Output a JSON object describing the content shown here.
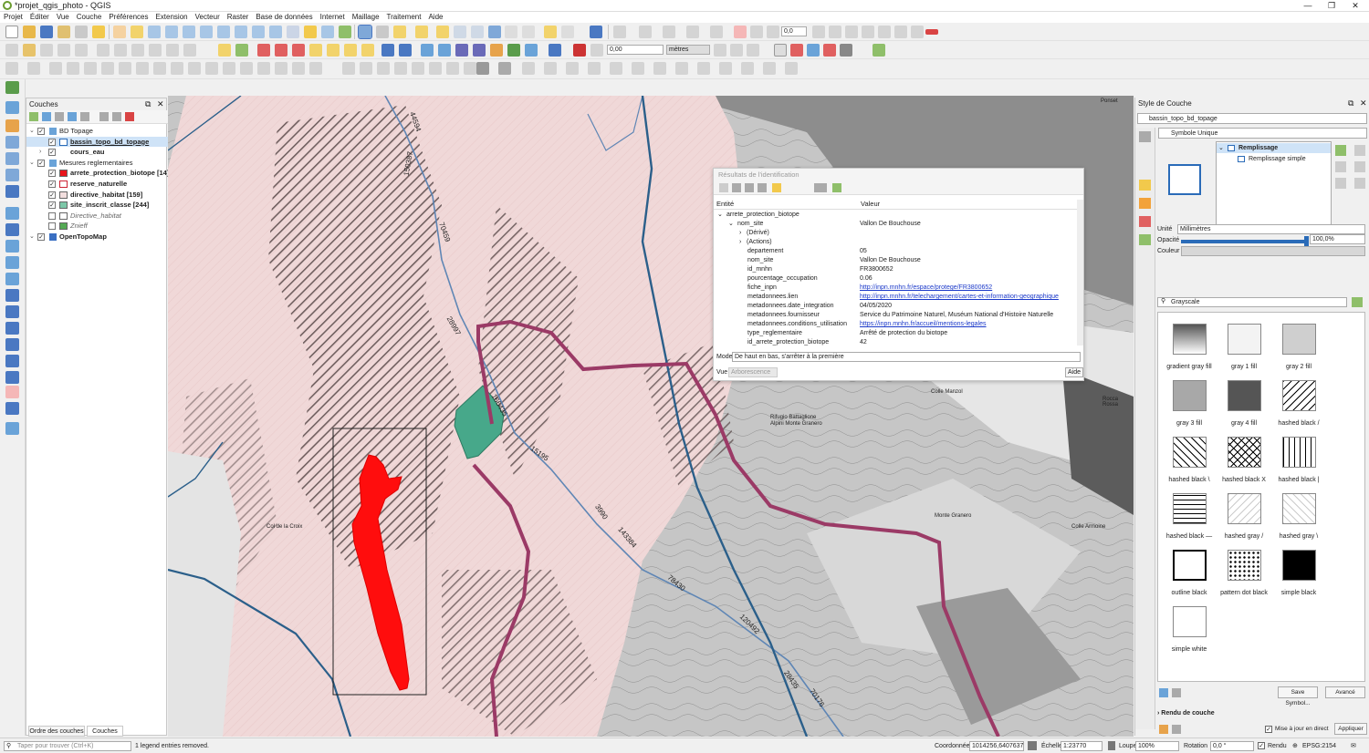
{
  "window": {
    "title": "*projet_qgis_photo - QGIS"
  },
  "menu": [
    "Projet",
    "Éditer",
    "Vue",
    "Couche",
    "Préférences",
    "Extension",
    "Vecteur",
    "Raster",
    "Base de données",
    "Internet",
    "Maillage",
    "Traitement",
    "Aide"
  ],
  "toolbar": {
    "scale_field": "0,00",
    "unit_field": "mètres",
    "rotation_field": "0,0"
  },
  "layers_panel": {
    "title": "Couches",
    "items": [
      {
        "label": "BD Topage",
        "checked": true,
        "group": true
      },
      {
        "label": "bassin_topo_bd_topage",
        "checked": true,
        "selected": true
      },
      {
        "label": "cours_eau",
        "checked": true
      },
      {
        "label": "Mesures reglementaires",
        "checked": true,
        "group": true
      },
      {
        "label": "arrete_protection_biotope [14]",
        "checked": true,
        "color": "#e8141b"
      },
      {
        "label": "reserve_naturelle",
        "checked": true,
        "color": "#ffffff"
      },
      {
        "label": "directive_habitat [159]",
        "checked": true,
        "color": "#f2dede"
      },
      {
        "label": "site_inscrit_classe [244]",
        "checked": true,
        "color": "#7cc7a8"
      },
      {
        "label": "Directive_habitat",
        "checked": false,
        "color": "#ffffff"
      },
      {
        "label": "Znieff",
        "checked": false,
        "color": "#55aa55"
      },
      {
        "label": "OpenTopoMap",
        "checked": true,
        "group": true
      }
    ],
    "tabs": [
      "Ordre des couches",
      "Couches"
    ]
  },
  "identify": {
    "title": "Résultats de l'identification",
    "col_entity": "Entité",
    "col_value": "Valeur",
    "layer": "arrete_protection_biotope",
    "rows": [
      {
        "k": "nom_site",
        "v": "Vallon De Bouchouse",
        "lvl": 1
      },
      {
        "k": "(Dérivé)",
        "v": "",
        "lvl": 2
      },
      {
        "k": "(Actions)",
        "v": "",
        "lvl": 2
      },
      {
        "k": "departement",
        "v": "05",
        "lvl": 3
      },
      {
        "k": "nom_site",
        "v": "Vallon De Bouchouse",
        "lvl": 3
      },
      {
        "k": "id_mnhn",
        "v": "FR3800652",
        "lvl": 3
      },
      {
        "k": "pourcentage_occupation",
        "v": "0.06",
        "lvl": 3
      },
      {
        "k": "fiche_inpn",
        "v": "http://inpn.mnhn.fr/espace/protege/FR3800652",
        "lvl": 3,
        "link": true
      },
      {
        "k": "metadonnees.lien",
        "v": "http://inpn.mnhn.fr/telechargement/cartes-et-information-geographique",
        "lvl": 3,
        "link": true
      },
      {
        "k": "metadonnees.date_integration",
        "v": "04/05/2020",
        "lvl": 3
      },
      {
        "k": "metadonnees.fournisseur",
        "v": "Service du Patrimoine Naturel, Muséum National d'Histoire Naturelle",
        "lvl": 3
      },
      {
        "k": "metadonnees.conditions_utilisation",
        "v": "https://inpn.mnhn.fr/accueil/mentions-legales",
        "lvl": 3,
        "link": true
      },
      {
        "k": "type_reglementaire",
        "v": "Arrêté de protection du biotope",
        "lvl": 3
      },
      {
        "k": "id_arrete_protection_biotope",
        "v": "42",
        "lvl": 3
      }
    ],
    "mode_label": "Mode",
    "mode_value": "De haut en bas, s'arrêter à la première",
    "vue_label": "Vue",
    "vue_value": "Arborescence",
    "help": "Aide"
  },
  "map_labels": [
    {
      "t": "44594",
      "c": "#333"
    },
    {
      "t": "150387",
      "c": "#333"
    },
    {
      "t": "70459",
      "c": "#333"
    },
    {
      "t": "28997",
      "c": "#333"
    },
    {
      "t": "166435",
      "c": "#333"
    },
    {
      "t": "15195",
      "c": "#333"
    },
    {
      "t": "3990",
      "c": "#333"
    },
    {
      "t": "143384",
      "c": "#333"
    },
    {
      "t": "78430",
      "c": "#333"
    },
    {
      "t": "120492",
      "c": "#333"
    },
    {
      "t": "28435",
      "c": "#333"
    },
    {
      "t": "70176",
      "c": "#333"
    },
    {
      "t": "Ponset",
      "c": "#333"
    },
    {
      "t": "Rifugio Battaglione Alpini Monte Granero",
      "c": "#333"
    },
    {
      "t": "Monte Granero",
      "c": "#333"
    },
    {
      "t": "Colle Manzol",
      "c": "#333"
    },
    {
      "t": "Rocca Rossa",
      "c": "#333"
    },
    {
      "t": "Colle Armoine",
      "c": "#333"
    },
    {
      "t": "Col de la Croix",
      "c": "#333"
    }
  ],
  "style_panel": {
    "title": "Style de Couche",
    "layer": "bassin_topo_bd_topage",
    "renderer": "Symbole Unique",
    "tree": [
      "Remplissage",
      "Remplissage simple"
    ],
    "unit_label": "Unité",
    "unit_value": "Millimètres",
    "opacity_label": "Opacité",
    "opacity_value": "100,0%",
    "opacity": 1.0,
    "color_label": "Couleur",
    "search_value": "Grayscale",
    "fills": [
      {
        "label": "gradient  gray fill",
        "kind": "gradient"
      },
      {
        "label": "gray 1 fill",
        "kind": "g1"
      },
      {
        "label": "gray 2 fill",
        "kind": "g2"
      },
      {
        "label": "gray 3 fill",
        "kind": "g3"
      },
      {
        "label": "gray 4 fill",
        "kind": "g4"
      },
      {
        "label": "hashed black /",
        "kind": "h1"
      },
      {
        "label": "hashed black \\",
        "kind": "h2"
      },
      {
        "label": "hashed black X",
        "kind": "hx"
      },
      {
        "label": "hashed black |",
        "kind": "hv"
      },
      {
        "label": "hashed black —",
        "kind": "hh"
      },
      {
        "label": "hashed gray /",
        "kind": "hg1"
      },
      {
        "label": "hashed gray \\",
        "kind": "hg2"
      },
      {
        "label": "outline black",
        "kind": "outline"
      },
      {
        "label": "pattern dot black",
        "kind": "dot"
      },
      {
        "label": "simple  black",
        "kind": "black"
      },
      {
        "label": "simple  white",
        "kind": "white"
      }
    ],
    "save_symbol": "Save Symbol...",
    "advanced": "Avancé",
    "rendering": "Rendu de couche",
    "live_update": "Mise à jour en direct",
    "apply": "Appliquer"
  },
  "statusbar": {
    "search_placeholder": "Taper pour trouver (Ctrl+K)",
    "message": "1 legend entries removed.",
    "coord_label": "Coordonnée",
    "coord_value": "1014256,6407637",
    "scale_label": "Échelle",
    "scale_value": "1:23770",
    "magnifier_label": "Loupe",
    "magnifier_value": "100%",
    "rotation_label": "Rotation",
    "rotation_value": "0,0 °",
    "render_label": "Rendu",
    "crs": "EPSG:2154"
  },
  "colors": {
    "accent": "#9b3a66",
    "biotope": "#ff0d0d",
    "site": "#47a88a",
    "habitat": "#f2d9d9",
    "river": "#2b5f8a"
  }
}
